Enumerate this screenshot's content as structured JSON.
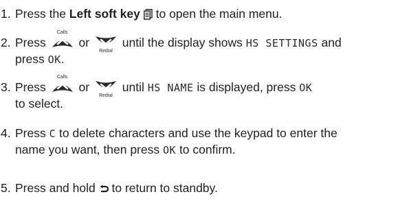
{
  "steps": [
    {
      "number": "1.",
      "t1": "Press the ",
      "bold": "Left soft key",
      "t2": " to open the main menu.",
      "icon": "menu-book-icon"
    },
    {
      "number": "2.",
      "t1": "Press",
      "or": "or",
      "t2": "until the display shows",
      "display_text": "HS SETTINGS",
      "t3": "and",
      "line2_prefix": "press",
      "line2_display": "OK",
      "line2_suffix": ".",
      "up_label": "Calls",
      "down_label": "Redial"
    },
    {
      "number": "3.",
      "t1": "Press",
      "or": "or",
      "t2": "until",
      "display_text": "HS NAME",
      "t3": "is displayed, press",
      "display_text2": "OK",
      "line2": "to select.",
      "up_label": "Calls",
      "down_label": "Redial"
    },
    {
      "number": "4.",
      "t1": "Press",
      "display_text": "C",
      "t2": "to delete characters and use the keypad to enter the",
      "line2_prefix": "name you want, then press",
      "line2_display": "OK",
      "line2_suffix": "to confirm."
    },
    {
      "number": "5.",
      "t1": "Press and hold",
      "t2": "to return to standby.",
      "icon": "back-arrow-icon"
    }
  ]
}
